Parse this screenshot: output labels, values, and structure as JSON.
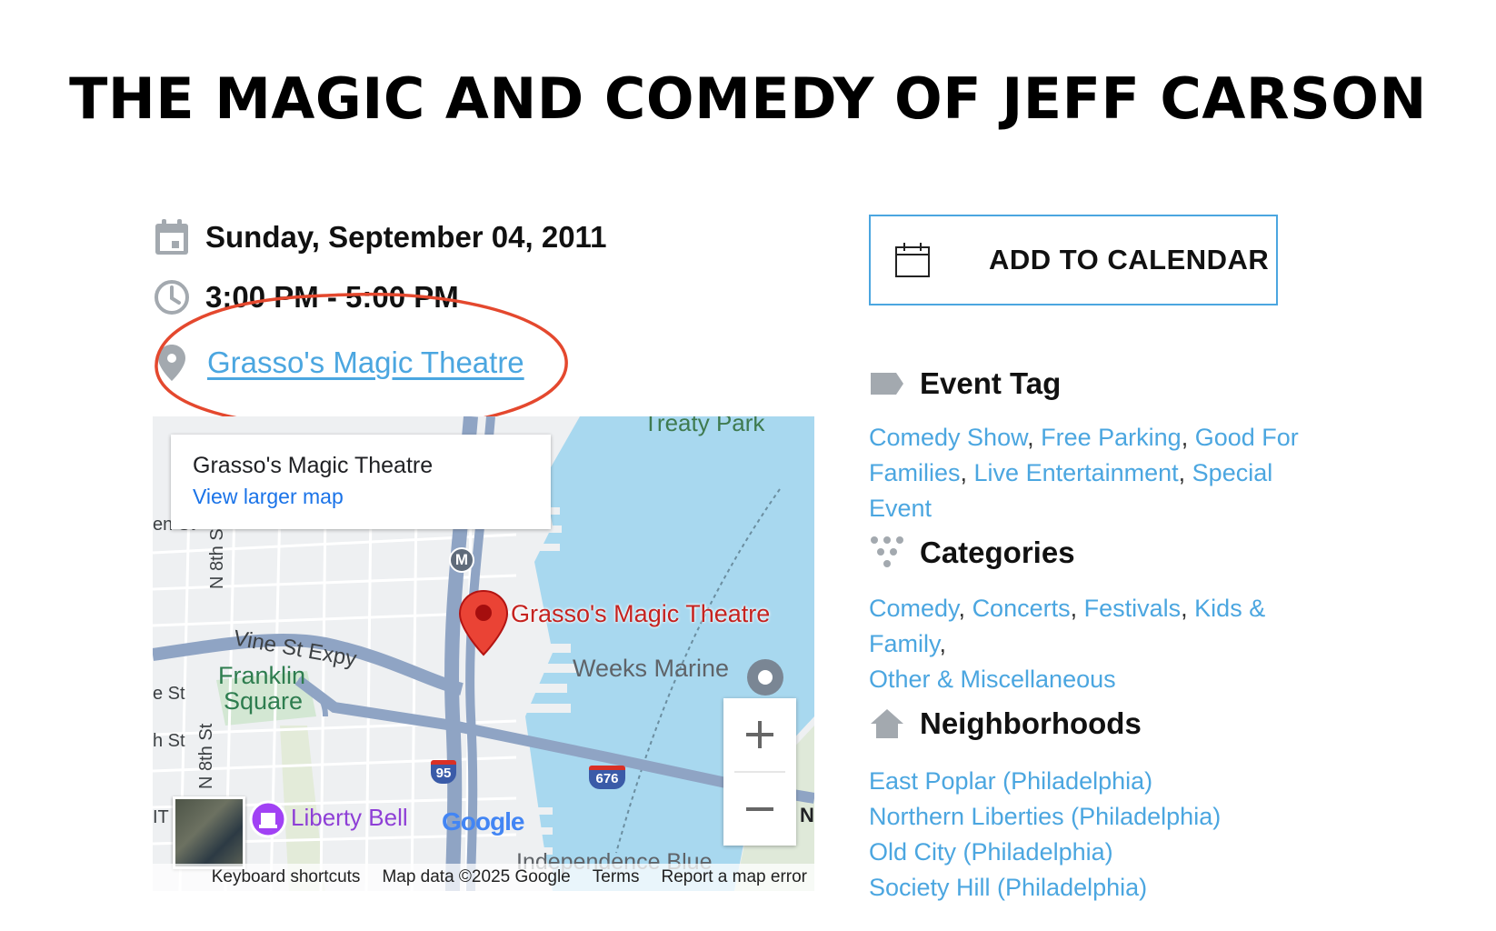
{
  "page": {
    "title": "THE MAGIC AND COMEDY OF JEFF CARSON"
  },
  "event": {
    "date": "Sunday, September 04, 2011",
    "time": "3:00 PM - 5:00 PM",
    "venue": "Grasso's Magic Theatre"
  },
  "map": {
    "card_title": "Grasso's Magic Theatre",
    "card_link": "View larger map",
    "pin_label": "Grasso's Magic Theatre",
    "labels": {
      "treaty_park": "Treaty Park",
      "n8th_st_top": "N 8th St",
      "n8th_st_bottom": "N 8th St",
      "vine_st": "Vine St Expy",
      "franklin": "Franklin",
      "square": "Square",
      "weeks_marine": "Weeks Marine",
      "liberty_bell": "Liberty Bell",
      "independence": "Independence Blue",
      "e_st": "e St",
      "h_st": "h St",
      "en_st": "en St",
      "it": "IT",
      "n_edge": "N",
      "metro": "M",
      "i95": "95",
      "i676": "676",
      "google": "Google"
    },
    "footer": {
      "shortcuts": "Keyboard shortcuts",
      "map_data": "Map data ©2025 Google",
      "terms": "Terms",
      "report": "Report a map error"
    },
    "colors": {
      "water": "#a8d8ef",
      "land": "#eef0f2",
      "highway": "#8fa4c4",
      "pin": "#ea4335"
    }
  },
  "sidebar": {
    "calendar_button": "ADD TO CALENDAR",
    "event_tag": {
      "heading": "Event Tag",
      "items": [
        "Comedy Show",
        "Free Parking",
        "Good For Families",
        "Live Entertainment",
        "Special Event"
      ]
    },
    "categories": {
      "heading": "Categories",
      "items": [
        "Comedy",
        "Concerts",
        "Festivals",
        "Kids & Family",
        "Other & Miscellaneous"
      ]
    },
    "neighborhoods": {
      "heading": "Neighborhoods",
      "items": [
        "East Poplar (Philadelphia)",
        "Northern Liberties (Philadelphia)",
        "Old City (Philadelphia)",
        "Society Hill (Philadelphia)"
      ]
    }
  },
  "colors": {
    "link": "#4ba6e0",
    "annotation": "#e4482e",
    "icon_gray": "#a3a9af"
  }
}
